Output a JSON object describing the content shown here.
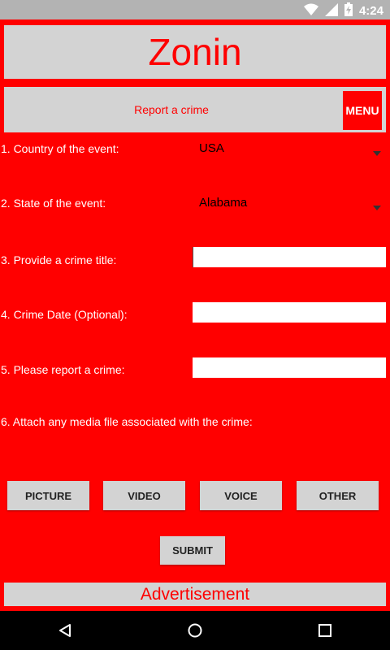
{
  "status_bar": {
    "time": "4:24",
    "icons": [
      "wifi-icon",
      "signal-icon",
      "battery-charging-icon"
    ]
  },
  "header": {
    "title": "Zonin"
  },
  "subheader": {
    "title": "Report a crime",
    "menu_label": "MENU"
  },
  "form": {
    "country_label": "1. Country of the event:",
    "country_value": "USA",
    "state_label": "2. State of the event:",
    "state_value": "Alabama",
    "title_label": "3. Provide a crime title:",
    "title_value": "",
    "date_label": "4. Crime Date (Optional):",
    "date_value": "",
    "report_label": "5. Please report a crime:",
    "report_value": "",
    "media_label": "6. Attach any media file associated with the crime:"
  },
  "media_buttons": {
    "picture": "PICTURE",
    "video": "VIDEO",
    "voice": "VOICE",
    "other": "OTHER"
  },
  "submit_label": "SUBMIT",
  "advertisement": "Advertisement",
  "nav_bar": {
    "icons": [
      "back-icon",
      "home-icon",
      "recents-icon"
    ]
  },
  "colors": {
    "background": "#ff0000",
    "panel": "#d3d3d3",
    "accent_text": "#ff0000",
    "status_bar": "#b3b3b3",
    "nav_bar": "#000000"
  }
}
